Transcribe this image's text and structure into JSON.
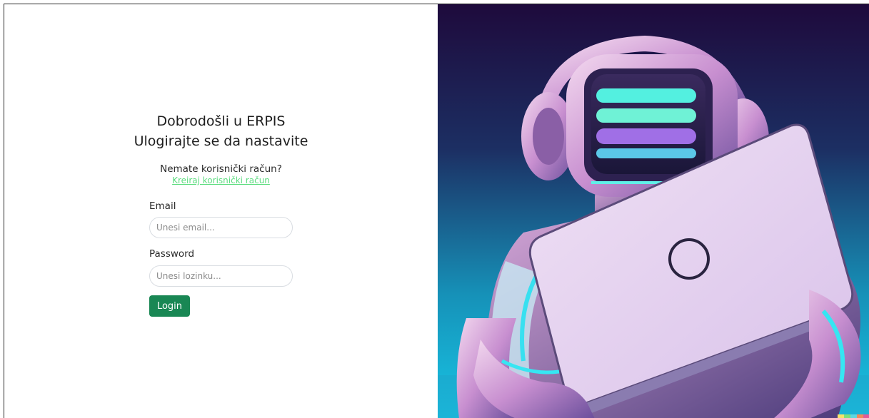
{
  "login": {
    "heading_line1": "Dobrodošli u ERPIS",
    "heading_line2": "Ulogirajte se da nastavite",
    "no_account_text": "Nemate korisnički račun?",
    "create_account_link": "Kreiraj korisnički račun",
    "email_label": "Email",
    "email_placeholder": "Unesi email...",
    "email_value": "",
    "password_label": "Password",
    "password_placeholder": "Unesi lozinku...",
    "password_value": "",
    "login_button": "Login"
  },
  "illustration": {
    "subject": "robot-with-laptop-illustration"
  },
  "colors": {
    "accent_link": "#5bdc7e",
    "login_button": "#198754",
    "art_sky_top": "#1e0a3c",
    "art_sky_bottom": "#18c6e6"
  }
}
